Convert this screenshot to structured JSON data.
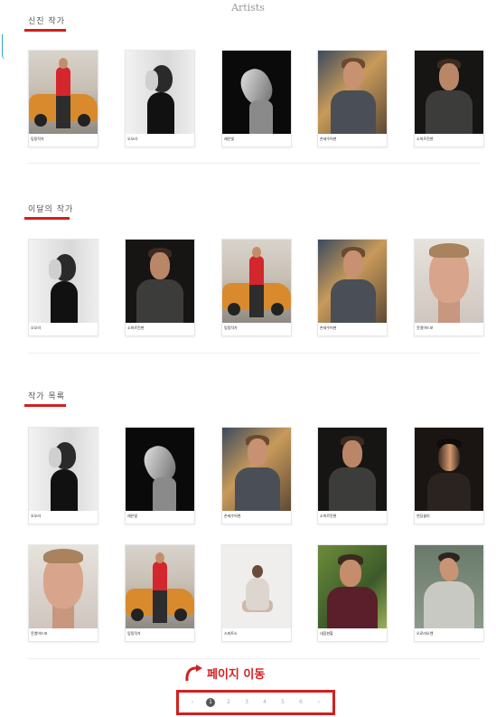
{
  "page": {
    "title": "Artists"
  },
  "sections": [
    {
      "title": "신진 작가",
      "cards": [
        {
          "name": "밍밍작가",
          "photo": "car"
        },
        {
          "name": "오오라",
          "photo": "bw"
        },
        {
          "name": "래은빛",
          "photo": "dark"
        },
        {
          "name": "손세수어현",
          "photo": "sun"
        },
        {
          "name": "소마르진현",
          "photo": "blk"
        }
      ]
    },
    {
      "title": "이달의 작가",
      "cards": [
        {
          "name": "오오라",
          "photo": "bw"
        },
        {
          "name": "소마르진현",
          "photo": "blk"
        },
        {
          "name": "밍밍작가",
          "photo": "car"
        },
        {
          "name": "손세수어현",
          "photo": "sun"
        },
        {
          "name": "웃앵어드포",
          "photo": "closeup"
        }
      ]
    },
    {
      "title": "작가 목록",
      "cards": [
        {
          "name": "오오라",
          "photo": "bw"
        },
        {
          "name": "래은빛",
          "photo": "dark"
        },
        {
          "name": "손세수어현",
          "photo": "sun"
        },
        {
          "name": "소마르진현",
          "photo": "blk"
        },
        {
          "name": "연딩솔미",
          "photo": "shadow"
        },
        {
          "name": "웃앵어드포",
          "photo": "closeup"
        },
        {
          "name": "밍밍작가",
          "photo": "car"
        },
        {
          "name": "스마트스",
          "photo": "sit"
        },
        {
          "name": "내짐현할",
          "photo": "forest"
        },
        {
          "name": "오로라오렌",
          "photo": "hoodie"
        }
      ]
    }
  ],
  "annotation": {
    "label": "페이지 이동"
  },
  "pagination": {
    "prev": "‹",
    "pages": [
      "1",
      "2",
      "3",
      "4",
      "5",
      "6"
    ],
    "active": "1",
    "next": "›"
  },
  "colors": {
    "accent_red": "#d21f1f"
  }
}
